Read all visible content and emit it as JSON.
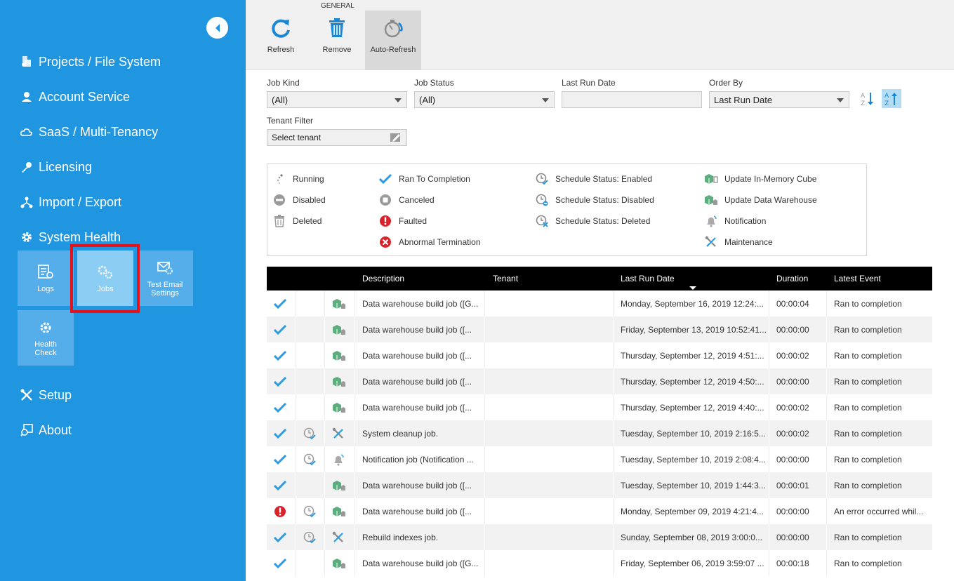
{
  "sidebar": {
    "nav": [
      {
        "label": "Projects / File System",
        "icon": "projects-icon"
      },
      {
        "label": "Account Service",
        "icon": "account-icon"
      },
      {
        "label": "SaaS / Multi-Tenancy",
        "icon": "cloud-icon"
      },
      {
        "label": "Licensing",
        "icon": "key-icon"
      },
      {
        "label": "Import / Export",
        "icon": "import-export-icon"
      },
      {
        "label": "System Health",
        "icon": "gear-icon"
      },
      {
        "label": "Setup",
        "icon": "tools-icon"
      },
      {
        "label": "About",
        "icon": "about-icon"
      }
    ],
    "tiles": [
      {
        "label": "Logs",
        "icon": "logs-icon"
      },
      {
        "label": "Jobs",
        "icon": "jobs-icon",
        "active": true
      },
      {
        "label": "Test Email Settings",
        "icon": "email-settings-icon"
      },
      {
        "label": "Health Check",
        "icon": "health-check-icon"
      }
    ]
  },
  "toolbar": {
    "group_label": "GENERAL",
    "refresh_label": "Refresh",
    "remove_label": "Remove",
    "auto_refresh_label": "Auto-Refresh"
  },
  "filters": {
    "job_kind": {
      "label": "Job Kind",
      "value": "(All)"
    },
    "job_status": {
      "label": "Job Status",
      "value": "(All)"
    },
    "last_run_date": {
      "label": "Last Run Date",
      "value": ""
    },
    "order_by": {
      "label": "Order By",
      "value": "Last Run Date"
    },
    "tenant": {
      "label": "Tenant Filter",
      "placeholder": "Select tenant"
    }
  },
  "legend": {
    "running": "Running",
    "disabled": "Disabled",
    "deleted": "Deleted",
    "ran_to_completion": "Ran To Completion",
    "canceled": "Canceled",
    "faulted": "Faulted",
    "abnormal_termination": "Abnormal Termination",
    "schedule_enabled": "Schedule Status: Enabled",
    "schedule_disabled": "Schedule Status: Disabled",
    "schedule_deleted": "Schedule Status: Deleted",
    "update_cube": "Update In-Memory Cube",
    "update_dw": "Update Data Warehouse",
    "notification": "Notification",
    "maintenance": "Maintenance"
  },
  "table": {
    "columns": {
      "description": "Description",
      "tenant": "Tenant",
      "last_run_date": "Last Run Date",
      "duration": "Duration",
      "latest_event": "Latest Event"
    },
    "rows": [
      {
        "status": "success",
        "schedule": "",
        "kind": "dw",
        "description": "Data warehouse build job ([G...",
        "tenant": "",
        "last_run": "Monday, September 16, 2019 12:24:...",
        "duration": "00:00:04",
        "event": "Ran to completion"
      },
      {
        "status": "success",
        "schedule": "",
        "kind": "dw",
        "description": "Data warehouse build job ([...",
        "tenant": "",
        "last_run": "Friday, September 13, 2019 10:52:41...",
        "duration": "00:00:00",
        "event": "Ran to completion"
      },
      {
        "status": "success",
        "schedule": "",
        "kind": "dw",
        "description": "Data warehouse build job ([...",
        "tenant": "",
        "last_run": "Thursday, September 12, 2019 4:51:...",
        "duration": "00:00:02",
        "event": "Ran to completion"
      },
      {
        "status": "success",
        "schedule": "",
        "kind": "dw",
        "description": "Data warehouse build job ([...",
        "tenant": "",
        "last_run": "Thursday, September 12, 2019 4:50:...",
        "duration": "00:00:00",
        "event": "Ran to completion"
      },
      {
        "status": "success",
        "schedule": "",
        "kind": "dw",
        "description": "Data warehouse build job ([...",
        "tenant": "",
        "last_run": "Thursday, September 12, 2019 4:40:...",
        "duration": "00:00:02",
        "event": "Ran to completion"
      },
      {
        "status": "success",
        "schedule": "enabled",
        "kind": "maintenance",
        "description": "System cleanup job.",
        "tenant": "",
        "last_run": "Tuesday, September 10, 2019 2:16:5...",
        "duration": "00:00:02",
        "event": "Ran to completion"
      },
      {
        "status": "success",
        "schedule": "enabled",
        "kind": "notification",
        "description": "Notification job (Notification ...",
        "tenant": "",
        "last_run": "Tuesday, September 10, 2019 2:08:4...",
        "duration": "00:00:00",
        "event": "Ran to completion"
      },
      {
        "status": "success",
        "schedule": "",
        "kind": "dw",
        "description": "Data warehouse build job ([...",
        "tenant": "",
        "last_run": "Tuesday, September 10, 2019 1:44:3...",
        "duration": "00:00:01",
        "event": "Ran to completion"
      },
      {
        "status": "faulted",
        "schedule": "enabled",
        "kind": "dw",
        "description": "Data warehouse build job ([...",
        "tenant": "",
        "last_run": "Monday, September 09, 2019 4:21:4...",
        "duration": "00:00:00",
        "event": "An error occurred whil..."
      },
      {
        "status": "success",
        "schedule": "enabled",
        "kind": "maintenance",
        "description": "Rebuild indexes job.",
        "tenant": "",
        "last_run": "Sunday, September 08, 2019 3:00:0...",
        "duration": "00:00:00",
        "event": "Ran to completion"
      },
      {
        "status": "success",
        "schedule": "",
        "kind": "dw",
        "description": "Data warehouse build job ([G...",
        "tenant": "",
        "last_run": "Friday, September 06, 2019 3:59:07 ...",
        "duration": "00:00:18",
        "event": "Ran to completion"
      }
    ]
  },
  "colors": {
    "sidebar_bg": "#2196e0",
    "tile_bg": "#55aee9",
    "tile_active_bg": "#8ccdf3",
    "highlight": "#e3121b",
    "check": "#2e9be0",
    "fault": "#d9222a"
  }
}
